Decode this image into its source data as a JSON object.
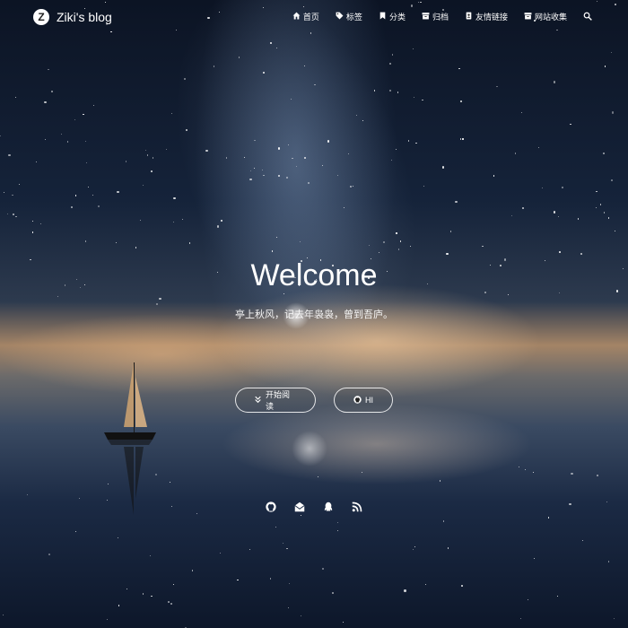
{
  "brand": {
    "logo_letter": "Z",
    "name": "Ziki's blog"
  },
  "nav": {
    "items": [
      {
        "label": "首页",
        "icon": "home-icon"
      },
      {
        "label": "标签",
        "icon": "tags-icon"
      },
      {
        "label": "分类",
        "icon": "bookmark-icon"
      },
      {
        "label": "归档",
        "icon": "archive-icon"
      },
      {
        "label": "友情链接",
        "icon": "address-book-icon"
      },
      {
        "label": "网站收集",
        "icon": "archive-icon"
      }
    ],
    "search_icon": "search-icon"
  },
  "hero": {
    "title": "Welcome",
    "subtitle": "亭上秋风，记去年袅袅，曾到吾庐。",
    "buttons": {
      "read": {
        "label": "开始阅读",
        "icon": "double-chevron-down-icon"
      },
      "hi": {
        "label": "HI",
        "icon": "github-icon"
      }
    }
  },
  "social": [
    {
      "icon": "github-icon"
    },
    {
      "icon": "envelope-open-icon"
    },
    {
      "icon": "qq-icon"
    },
    {
      "icon": "rss-icon"
    }
  ],
  "colors": {
    "text": "#ffffff",
    "sky_top": "#0c1424",
    "horizon": "#a48466"
  }
}
